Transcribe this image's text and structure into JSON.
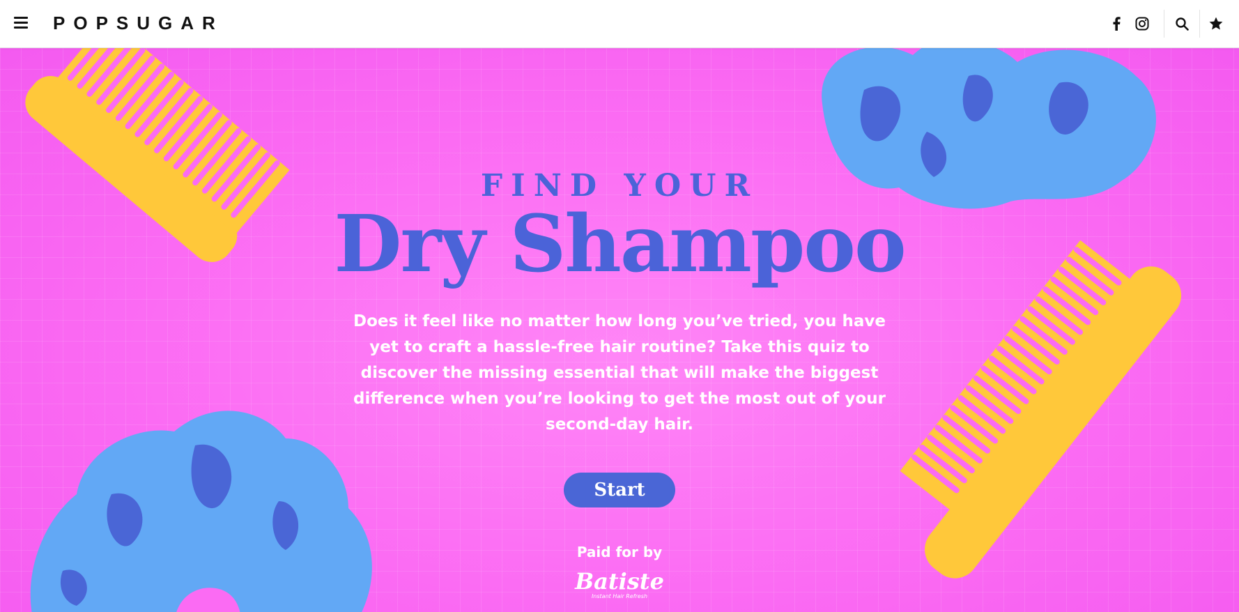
{
  "header": {
    "brand": "POPSUGAR",
    "menu_icon": "hamburger-menu-icon",
    "social_icons": [
      "facebook-icon",
      "instagram-icon"
    ],
    "action_icons": [
      "search-icon",
      "star-icon"
    ]
  },
  "hero": {
    "eyebrow": "FIND YOUR",
    "headline": "Dry Shampoo",
    "intro": "Does it feel like no matter how long you’ve tried, you have yet to craft a hassle-free hair routine? Take this quiz to discover the missing essential that will make the biggest difference when you’re looking to get the most out of your second-day hair.",
    "start_label": "Start",
    "paid_for_label": "Paid for by",
    "sponsor_name": "Batiste",
    "sponsor_tagline": "Instant Hair Refresh"
  },
  "colors": {
    "background_pink": "#fb6bf3",
    "headline_blue": "#4b63d8",
    "button_blue": "#4a66d6",
    "comb_yellow": "#ffc83a",
    "scrunchie_blue": "#62a8f5",
    "text_white": "#ffffff"
  }
}
